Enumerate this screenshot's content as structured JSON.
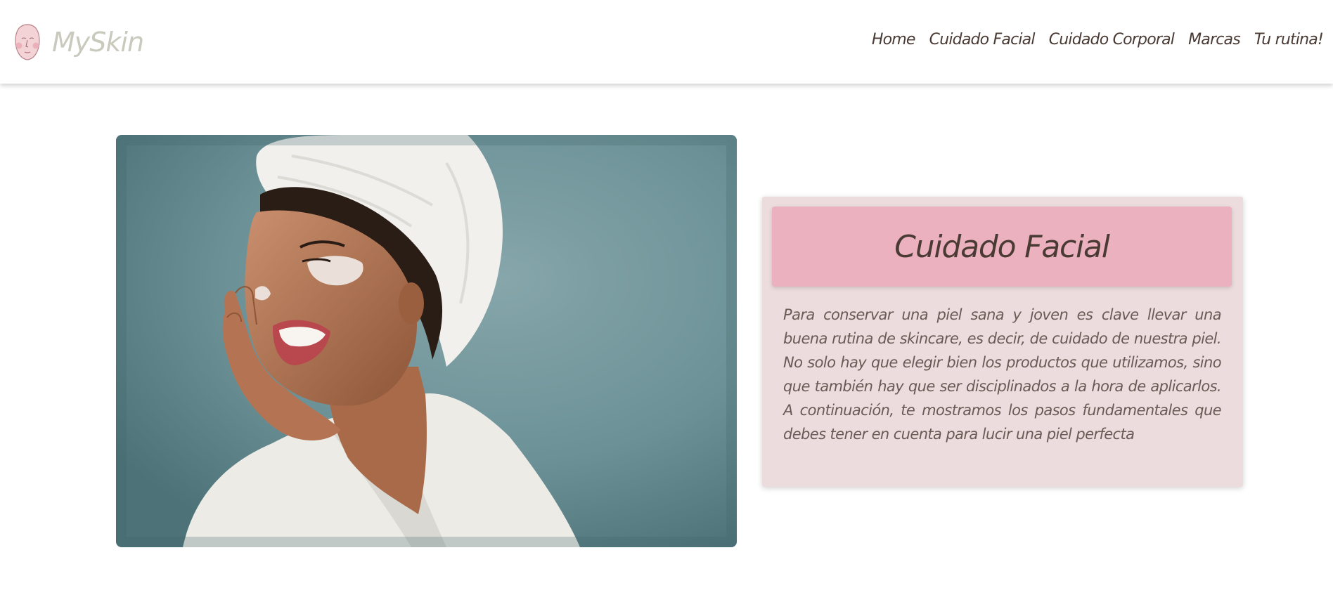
{
  "header": {
    "brand_name": "MySkin",
    "logo_icon": "face-icon",
    "nav": [
      {
        "label": "Home"
      },
      {
        "label": "Cuidado Facial"
      },
      {
        "label": "Cuidado Corporal"
      },
      {
        "label": "Marcas"
      },
      {
        "label": "Tu rutina!"
      }
    ]
  },
  "hero": {
    "image_subject": "woman-towel-eye-patches-photo"
  },
  "card": {
    "title": "Cuidado Facial",
    "text": "Para conservar una piel sana y joven es clave llevar una buena rutina de skincare, es decir, de cuidado de nuestra piel. No solo hay que elegir bien los productos que utilizamos, sino que también hay que ser disciplinados a la hora de aplicarlos. A continuación, te mostramos los pasos fundamentales que debes tener en cuenta para lucir una piel perfecta"
  },
  "colors": {
    "brand_text": "#c9c9bd",
    "nav_text": "#4a3a34",
    "card_bg": "#ecdcdd",
    "card_header_bg": "#ebb1bf",
    "photo_bg": "#6c959b"
  }
}
